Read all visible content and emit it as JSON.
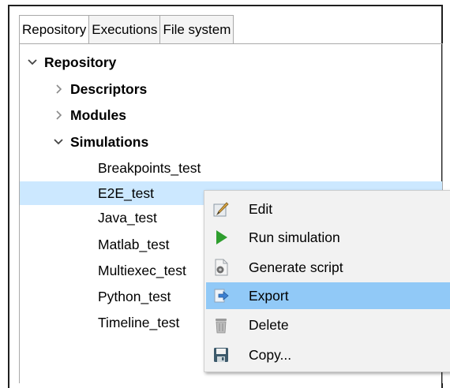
{
  "tabs": [
    {
      "label": "Repository",
      "active": true
    },
    {
      "label": "Executions",
      "active": false
    },
    {
      "label": "File system",
      "active": false
    }
  ],
  "tree": {
    "root": {
      "label": "Repository",
      "expanded": true
    },
    "folders": [
      {
        "label": "Descriptors",
        "expanded": false
      },
      {
        "label": "Modules",
        "expanded": false
      },
      {
        "label": "Simulations",
        "expanded": true
      }
    ],
    "simulations": [
      {
        "label": "Breakpoints_test",
        "selected": false
      },
      {
        "label": "E2E_test",
        "selected": true
      },
      {
        "label": "Java_test",
        "selected": false
      },
      {
        "label": "Matlab_test",
        "selected": false
      },
      {
        "label": "Multiexec_test",
        "selected": false
      },
      {
        "label": "Python_test",
        "selected": false
      },
      {
        "label": "Timeline_test",
        "selected": false
      }
    ]
  },
  "context_menu": {
    "items": [
      {
        "label": "Edit",
        "icon": "edit-icon"
      },
      {
        "label": "Run simulation",
        "icon": "run-icon"
      },
      {
        "label": "Generate script",
        "icon": "generate-script-icon"
      },
      {
        "label": "Export",
        "icon": "export-icon",
        "highlighted": true
      },
      {
        "label": "Delete",
        "icon": "trash-icon"
      },
      {
        "label": "Copy...",
        "icon": "save-copy-icon"
      }
    ]
  },
  "colors": {
    "selection": "#cce8ff",
    "menu_highlight": "#91c9f7",
    "menu_background": "#f2f2f2",
    "run_green": "#2e9e2e"
  }
}
